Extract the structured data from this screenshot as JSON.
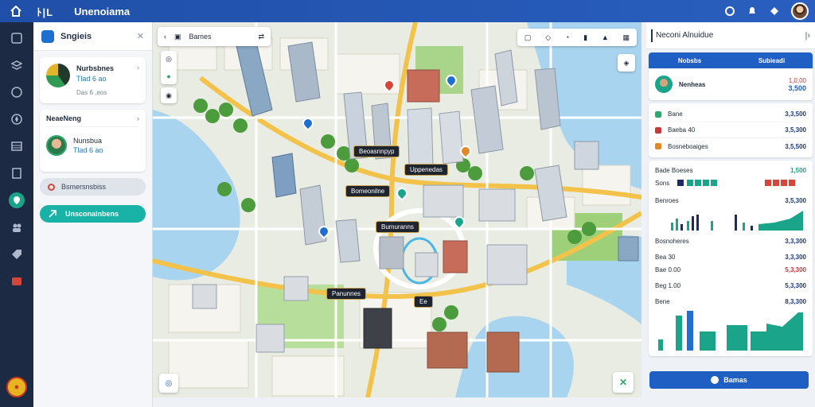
{
  "topbar": {
    "brand": "ﾄ|L",
    "title": "Unenoiama"
  },
  "left_panel": {
    "header_title": "Sngieis",
    "card1": {
      "line1": "Nurbsbnes",
      "line2": "Tlad 6 ao",
      "line3": "Das 6 ,eos"
    },
    "card2": {
      "title": "NeaeNeng",
      "name": "Nunsbua",
      "sub": "Tlad 6 ao"
    },
    "pill_grey": "Bsmersnsbiss",
    "pill_teal": "Unsconainbens"
  },
  "map": {
    "search_text": "Bames",
    "tags": [
      "Beoasnnpyp",
      "Uppenedas",
      "Bomeonilne",
      "Bumuranns",
      "Panunnes",
      "Ee"
    ]
  },
  "right_panel": {
    "header_title": "Neconi Alnuidue",
    "tabs": [
      "Nobsbs",
      "Subieadi"
    ],
    "person": {
      "name": "Nenheas",
      "v1": "1,0,00",
      "v2": "3,500"
    },
    "list": [
      {
        "label": "Bane",
        "value": "3,3,500",
        "color": "#2fa66a"
      },
      {
        "label": "Baeba 40",
        "value": "3,5,300",
        "color": "#c43a3a"
      },
      {
        "label": "Bosneboaiges",
        "value": "3,5,500",
        "color": "#e0892a"
      }
    ],
    "stats": [
      {
        "label": "Bade Boeses",
        "value": "1,500",
        "cls": "grn"
      },
      {
        "label": "Sons",
        "value": "",
        "cls": ""
      },
      {
        "label": "Benroes",
        "value": "3,5,300",
        "cls": ""
      },
      {
        "label": "Bosnoheres",
        "value": "3,3,300",
        "cls": ""
      },
      {
        "label": "Bea 30",
        "value": "3,3,300",
        "cls": ""
      },
      {
        "label": "Bae 0.00",
        "value": "5,3,300",
        "cls": "red"
      },
      {
        "label": "Beg 1.00",
        "value": "5,3,300",
        "cls": ""
      },
      {
        "label": "Bene",
        "value": "8,3,300",
        "cls": ""
      }
    ],
    "button": "Bamas"
  },
  "colors": {
    "accent": "#1f5fc4",
    "teal": "#18b3a6",
    "rail": "#1d2a44"
  }
}
